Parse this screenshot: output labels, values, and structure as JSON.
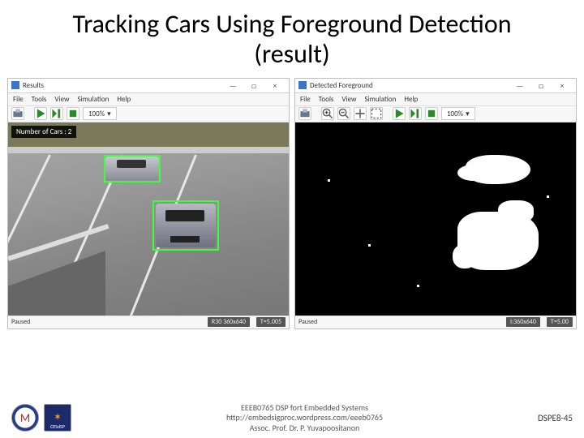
{
  "title": "Tracking Cars Using Foreground Detection (result)",
  "left_window": {
    "title": "Results",
    "menu": [
      "File",
      "Tools",
      "View",
      "Simulation",
      "Help"
    ],
    "zoom": "100%",
    "overlay": "Number of Cars : 2",
    "status_left": "Paused",
    "status_mid": "R30 360x640",
    "status_right": "T=5.005"
  },
  "right_window": {
    "title": "Detected Foreground",
    "menu": [
      "File",
      "Tools",
      "View",
      "Simulation",
      "Help"
    ],
    "zoom": "100%",
    "status_left": "Paused",
    "status_mid": "I:360x640",
    "status_right": "T=5.00"
  },
  "footer": {
    "line1": "EEEB0765 DSP fort Embedded Systems",
    "line2": "http://embedsigproc.wordpress.com/eeeb0765",
    "line3": "Assoc. Prof. Dr. P. Yuvapoositanon",
    "page": "DSPE8-45",
    "logo2_text": "CESdSP"
  },
  "icons": {
    "min": "—",
    "max": "□",
    "close": "×",
    "dropdown": "▾",
    "star": "✶"
  }
}
